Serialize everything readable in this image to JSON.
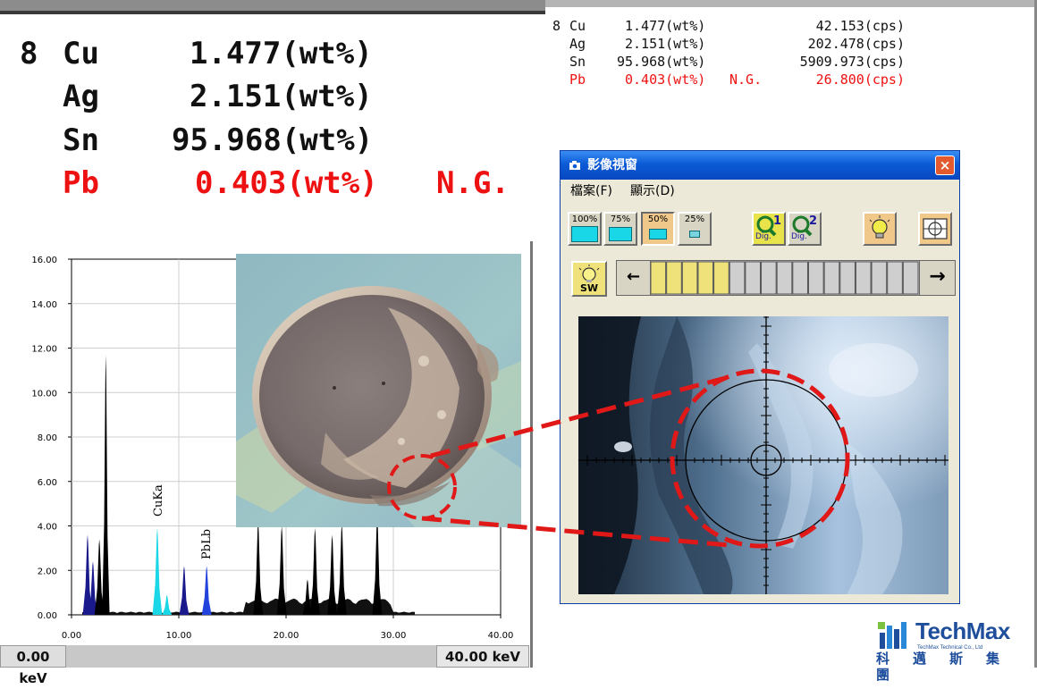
{
  "composition_large": {
    "index": "8",
    "rows": [
      {
        "element": "Cu",
        "value": "1.477(wt%)",
        "flag": ""
      },
      {
        "element": "Ag",
        "value": "2.151(wt%)",
        "flag": ""
      },
      {
        "element": "Sn",
        "value": "95.968(wt%)",
        "flag": ""
      },
      {
        "element": "Pb",
        "value": "0.403(wt%)",
        "flag": "N.G."
      }
    ]
  },
  "composition_small": {
    "index": "8",
    "rows": [
      {
        "element": "Cu",
        "value": "1.477(wt%)",
        "flag": "",
        "cps": "42.153(cps)"
      },
      {
        "element": "Ag",
        "value": "2.151(wt%)",
        "flag": "",
        "cps": "202.478(cps)"
      },
      {
        "element": "Sn",
        "value": "95.968(wt%)",
        "flag": "",
        "cps": "5909.973(cps)"
      },
      {
        "element": "Pb",
        "value": "0.403(wt%)",
        "flag": "N.G.",
        "cps": "26.800(cps)"
      }
    ]
  },
  "colors": {
    "accent_red": "#ee1111",
    "title_blue": "#0b5bd6",
    "lamp_yellow": "#f0e27a"
  },
  "spectrum": {
    "range_start": "0.00 keV",
    "range_end": "40.00 keV",
    "peak_labels": [
      "CuKa",
      "PbLb"
    ]
  },
  "chart_data": {
    "type": "area",
    "title": "",
    "xlabel": "",
    "ylabel": "",
    "xlim": [
      0,
      40
    ],
    "ylim": [
      0,
      16
    ],
    "x_ticks": [
      "0.00",
      "10.00",
      "20.00",
      "30.00",
      "40.00"
    ],
    "y_ticks": [
      "0.00",
      "2.00",
      "4.00",
      "6.00",
      "8.00",
      "10.00",
      "12.00",
      "14.00",
      "16.00"
    ],
    "grid": true,
    "peaks": [
      {
        "x": 1.5,
        "y": 3.6,
        "color": "#1a1a8c"
      },
      {
        "x": 2.0,
        "y": 2.4,
        "color": "#1a1a8c"
      },
      {
        "x": 2.6,
        "y": 3.4,
        "color": "#000000"
      },
      {
        "x": 3.2,
        "y": 11.7,
        "color": "#000000"
      },
      {
        "x": 8.0,
        "y": 3.9,
        "color": "#19d7e6"
      },
      {
        "x": 8.9,
        "y": 0.9,
        "color": "#19d7e6"
      },
      {
        "x": 10.5,
        "y": 2.2,
        "color": "#1a1a8c"
      },
      {
        "x": 12.6,
        "y": 2.2,
        "color": "#2244dd"
      },
      {
        "x": 17.4,
        "y": 4.2,
        "color": "#000000"
      },
      {
        "x": 19.6,
        "y": 4.0,
        "color": "#000000"
      },
      {
        "x": 22.0,
        "y": 1.6,
        "color": "#000000"
      },
      {
        "x": 22.7,
        "y": 3.9,
        "color": "#000000"
      },
      {
        "x": 24.3,
        "y": 3.6,
        "color": "#000000"
      },
      {
        "x": 25.2,
        "y": 4.1,
        "color": "#000000"
      },
      {
        "x": 28.5,
        "y": 4.5,
        "color": "#000000"
      }
    ]
  },
  "window": {
    "title": "影像視窗",
    "close_label": "×",
    "menu": [
      "檔案(F)",
      "顯示(D)"
    ],
    "zoom_buttons": [
      "100%",
      "75%",
      "50%",
      "25%"
    ],
    "zoom_selected": "50%",
    "dig_buttons": [
      {
        "num": "1",
        "label": "Dig."
      },
      {
        "num": "2",
        "label": "Dig."
      }
    ],
    "sw_label": "SW",
    "arrow_left": "←",
    "arrow_right": "→",
    "brightness_level": 0.3
  },
  "logo": {
    "name": "TechMax",
    "sub": "TechMax Technical Co., Ltd",
    "chinese": "科邁斯集團"
  }
}
